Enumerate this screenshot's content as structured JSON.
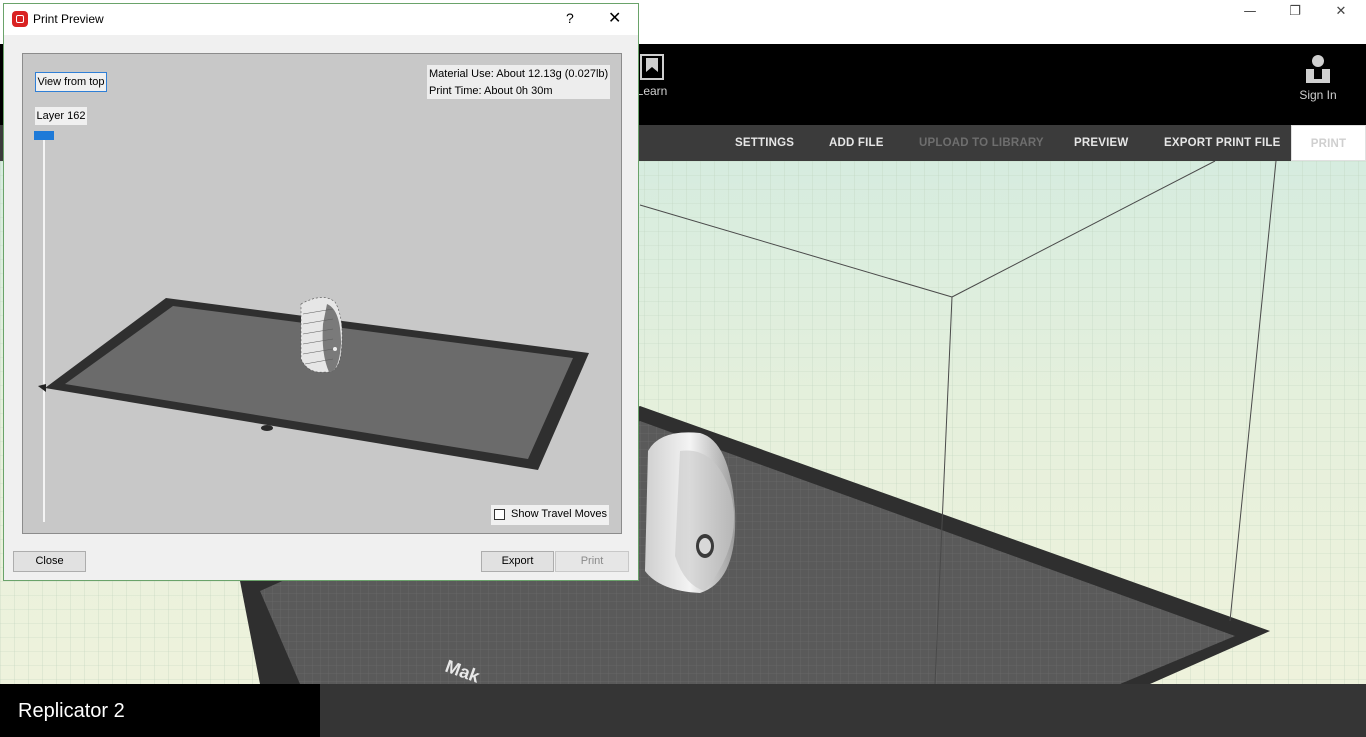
{
  "window": {
    "minimize": "—",
    "restore": "❐",
    "close": "✕"
  },
  "header": {
    "learn_label": "Learn",
    "signin_label": "Sign In"
  },
  "toolbar": {
    "settings": "SETTINGS",
    "add_file": "ADD FILE",
    "upload": "UPLOAD TO LIBRARY",
    "preview": "PREVIEW",
    "export": "EXPORT PRINT FILE",
    "print": "PRINT"
  },
  "footer": {
    "printer": "Replicator 2"
  },
  "scene": {
    "plate_text": "Mak"
  },
  "dialog": {
    "title": "Print Preview",
    "help": "?",
    "close_icon": "✕",
    "view_from_top": "View from top",
    "layer_label": "Layer 162",
    "layer_slider_value": 1.0,
    "material": "Material Use: About 12.13g (0.027lb)",
    "print_time": "Print Time: About 0h 30m",
    "show_travel": "Show Travel Moves",
    "show_travel_checked": false,
    "close_button": "Close",
    "export_button": "Export",
    "print_button": "Print"
  },
  "colors": {
    "accent_blue": "#1e7ad8",
    "toolbar_bg": "#3b3b3b",
    "header_bg": "#000000",
    "dialog_border": "#6aa36a"
  }
}
